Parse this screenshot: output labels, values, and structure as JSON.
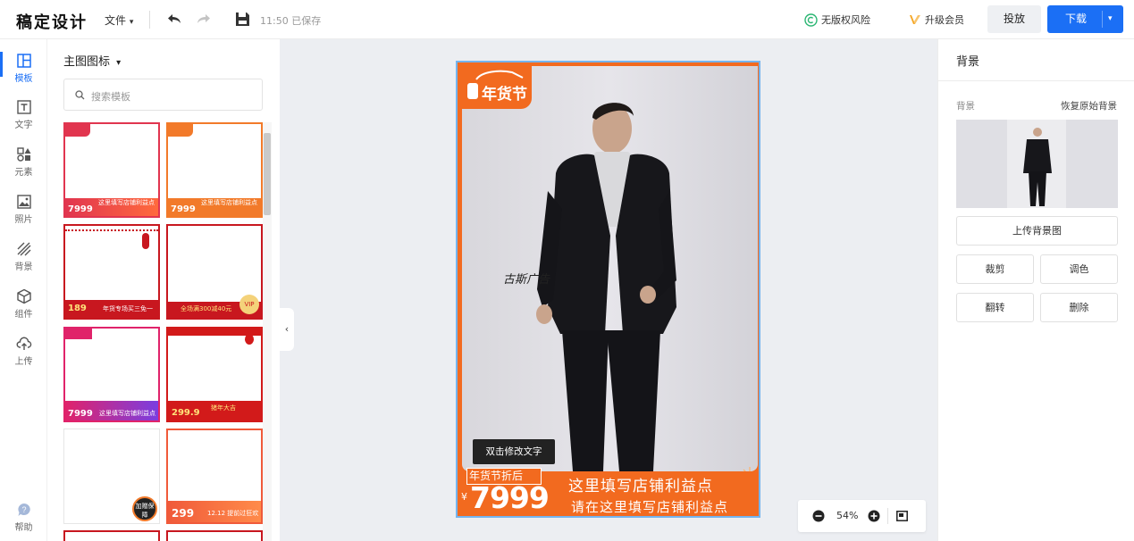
{
  "app": {
    "logo": "稿定设计"
  },
  "toolbar": {
    "file_label": "文件",
    "file_caret": "▾",
    "saved_text": "11:50 已保存",
    "copyright_label": "无版权风险",
    "upgrade_label": "升级会员",
    "publish_label": "投放",
    "download_label": "下载",
    "download_caret": "▾"
  },
  "left_nav": {
    "items": [
      {
        "label": "模板",
        "icon": "layout-icon"
      },
      {
        "label": "文字",
        "icon": "text-icon"
      },
      {
        "label": "元素",
        "icon": "elements-icon"
      },
      {
        "label": "照片",
        "icon": "photo-icon"
      },
      {
        "label": "背景",
        "icon": "background-icon"
      },
      {
        "label": "组件",
        "icon": "component-icon"
      },
      {
        "label": "上传",
        "icon": "upload-icon"
      }
    ],
    "help_label": "帮助"
  },
  "template_panel": {
    "title": "主图图标",
    "title_caret": "▾",
    "search_placeholder": "搜索模板",
    "thumbnails": [
      {
        "price": "7999",
        "text": "这里填写店铺利益点",
        "theme": "pink-red"
      },
      {
        "price": "7999",
        "text": "这里填写店铺利益点",
        "theme": "orange"
      },
      {
        "price": "189",
        "text": "年货专场买三免一",
        "theme": "red"
      },
      {
        "price": "",
        "text": "全场满300减40元",
        "theme": "red-gold"
      },
      {
        "price": "7999",
        "text": "这里填写店铺利益点",
        "theme": "pink-purple"
      },
      {
        "price": "299.9",
        "text": "猪年大吉",
        "theme": "red-festival"
      },
      {
        "price": "",
        "text": "加赠保障",
        "theme": "white-black"
      },
      {
        "price": "299",
        "text": "12.12 提前过狂欢",
        "theme": "orange-red"
      }
    ]
  },
  "canvas": {
    "badge": "年货节",
    "double_click_tip": "双击修改文字",
    "sale_label": "年货节折后",
    "price_currency": "¥",
    "price": "7999",
    "benefit_line1": "这里填写店铺利益点",
    "benefit_line2": "请在这里填写店铺利益点",
    "signature": "古斯广告",
    "zoom": "54%"
  },
  "right_panel": {
    "title": "背景",
    "bg_label": "背景",
    "reset_label": "恢复原始背景",
    "upload_label": "上传背景图",
    "crop_label": "裁剪",
    "adjust_label": "调色",
    "flip_label": "翻转",
    "delete_label": "删除"
  },
  "colors": {
    "accent": "#1b6ff5",
    "poster_orange": "#f26a1f",
    "canvas_bg": "#eceef2"
  }
}
